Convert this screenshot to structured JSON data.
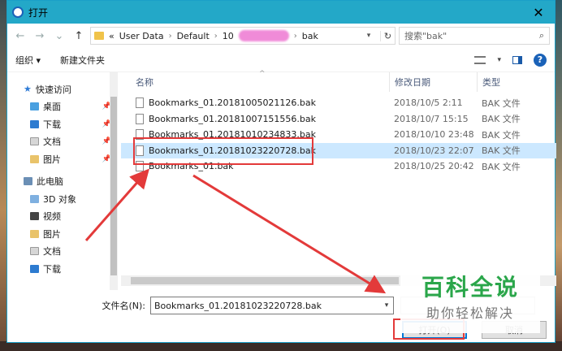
{
  "window": {
    "title": "打开",
    "close_glyph": "✕"
  },
  "address": {
    "breadcrumb_prefix": "«",
    "crumbs": [
      "User Data",
      "Default",
      "10"
    ],
    "last": "bak",
    "search_placeholder": "搜索\"bak\""
  },
  "toolbar": {
    "organize": "组织 ▾",
    "new_folder": "新建文件夹"
  },
  "sidebar": {
    "items": [
      {
        "label": "快速访问",
        "icon": "star-icon"
      },
      {
        "label": "桌面",
        "icon": "desktop-icon",
        "pinned": true
      },
      {
        "label": "下载",
        "icon": "download-icon",
        "pinned": true
      },
      {
        "label": "文档",
        "icon": "document-icon",
        "pinned": true
      },
      {
        "label": "图片",
        "icon": "picture-icon",
        "pinned": true
      },
      {
        "label": "此电脑",
        "icon": "pc-icon"
      },
      {
        "label": "3D 对象",
        "icon": "3d-object-icon"
      },
      {
        "label": "视频",
        "icon": "video-icon"
      },
      {
        "label": "图片",
        "icon": "picture-icon"
      },
      {
        "label": "文档",
        "icon": "document-icon"
      },
      {
        "label": "下载",
        "icon": "download-icon"
      }
    ]
  },
  "columns": {
    "name": "名称",
    "date": "修改日期",
    "type": "类型"
  },
  "files": [
    {
      "name": "Bookmarks_01.20181005021126.bak",
      "date": "2018/10/5 2:11",
      "type": "BAK 文件"
    },
    {
      "name": "Bookmarks_01.20181007151556.bak",
      "date": "2018/10/7 15:15",
      "type": "BAK 文件"
    },
    {
      "name": "Bookmarks_01.20181010234833.bak",
      "date": "2018/10/10 23:48",
      "type": "BAK 文件"
    },
    {
      "name": "Bookmarks_01.20181023220728.bak",
      "date": "2018/10/23 22:07",
      "type": "BAK 文件",
      "selected": true
    },
    {
      "name": "Bookmarks_01.bak",
      "date": "2018/10/25 20:42",
      "type": "BAK 文件"
    }
  ],
  "footer": {
    "filename_label": "文件名(N):",
    "filename_value": "Bookmarks_01.20181023220728.bak",
    "open_button": "打开(O)",
    "cancel_button": "取消"
  },
  "watermark": {
    "title": "百科全说",
    "subtitle": "助你轻松解决"
  },
  "colors": {
    "titlebar": "#23a8c8",
    "selection": "#cce8ff",
    "annotation": "#e33a3a",
    "watermark": "#2aa64a"
  }
}
